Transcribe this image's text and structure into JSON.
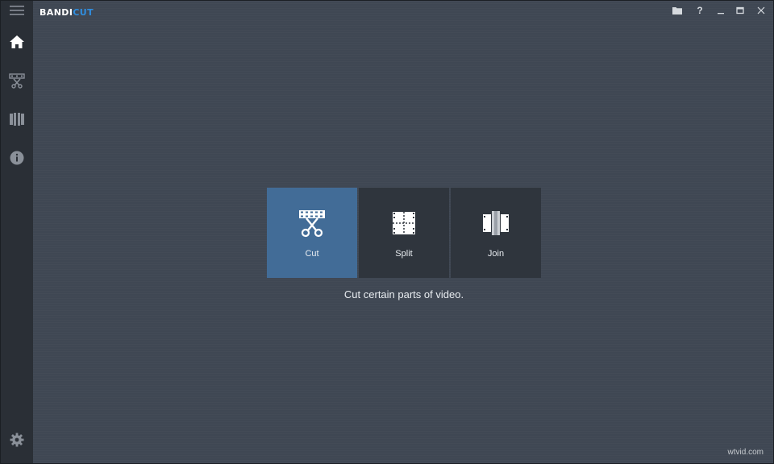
{
  "app": {
    "logo_part1": "BANDI",
    "logo_part2": "CUT",
    "brand_accent": "#2f8ee0"
  },
  "titlebar": {
    "buttons": [
      {
        "name": "open-folder",
        "icon": "folder-icon"
      },
      {
        "name": "help",
        "icon": "question-icon",
        "glyph": "?"
      },
      {
        "name": "minimize",
        "icon": "minimize-icon"
      },
      {
        "name": "maximize",
        "icon": "maximize-icon"
      },
      {
        "name": "close",
        "icon": "close-icon"
      }
    ]
  },
  "sidebar": {
    "items": [
      {
        "name": "menu",
        "icon": "hamburger-menu-icon"
      },
      {
        "name": "home",
        "icon": "home-icon",
        "active": true
      },
      {
        "name": "cut",
        "icon": "film-scissors-icon"
      },
      {
        "name": "join",
        "icon": "film-strips-icon"
      },
      {
        "name": "info",
        "icon": "info-icon"
      },
      {
        "name": "settings",
        "icon": "gear-icon"
      }
    ]
  },
  "modes": {
    "tiles": [
      {
        "label": "Cut",
        "icon": "scissors-film-icon",
        "selected": true
      },
      {
        "label": "Split",
        "icon": "split-grid-icon",
        "selected": false
      },
      {
        "label": "Join",
        "icon": "join-film-icon",
        "selected": false
      }
    ],
    "description": "Cut certain parts of video."
  },
  "colors": {
    "background": "#3f4753",
    "sidebar": "#2a2f36",
    "tile": "#2f353d",
    "tile_selected": "#426c97"
  },
  "watermark": "wtvid.com"
}
